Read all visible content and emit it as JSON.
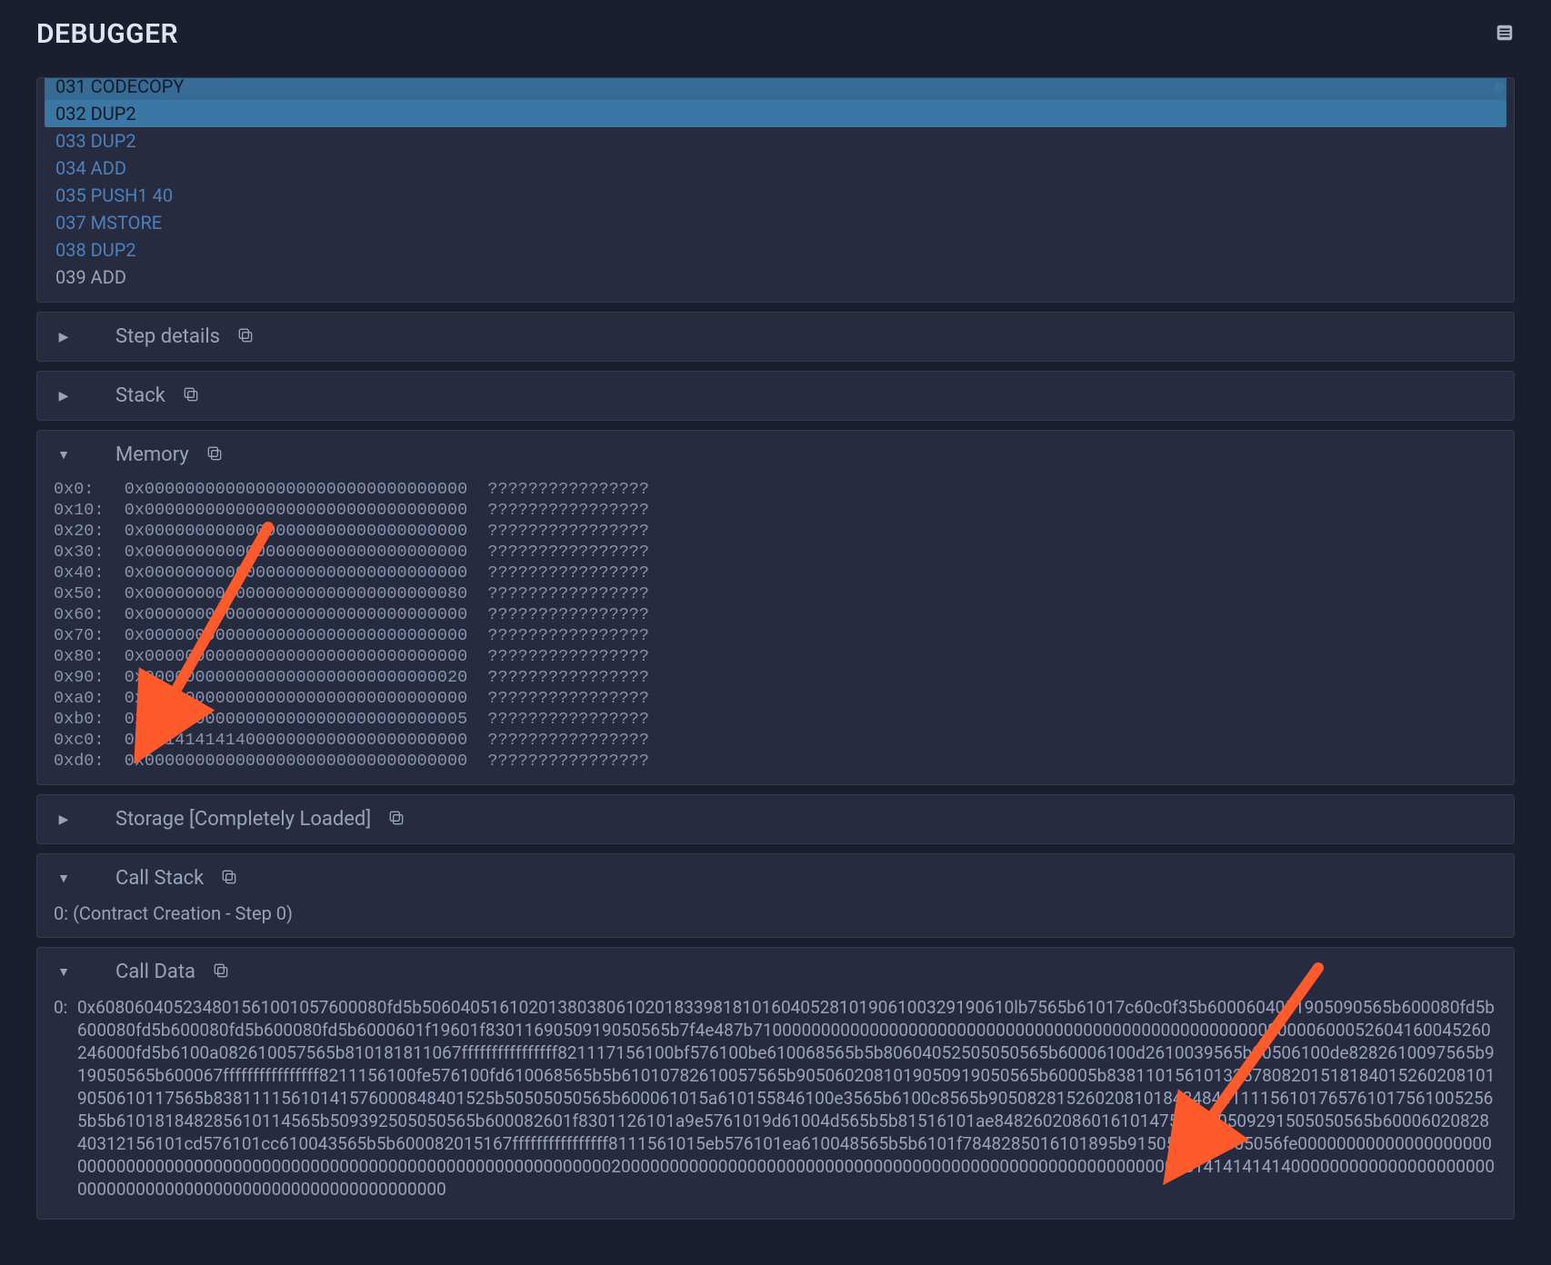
{
  "header": {
    "title": "DEBUGGER"
  },
  "opcodes": [
    {
      "text": "031 CODECOPY",
      "cls": "faded-top"
    },
    {
      "text": "032 DUP2",
      "cls": "current"
    },
    {
      "text": "033 DUP2",
      "cls": ""
    },
    {
      "text": "034 ADD",
      "cls": ""
    },
    {
      "text": "035 PUSH1 40",
      "cls": ""
    },
    {
      "text": "037 MSTORE",
      "cls": ""
    },
    {
      "text": "038 DUP2",
      "cls": ""
    },
    {
      "text": "039 ADD",
      "cls": "later"
    }
  ],
  "sections": {
    "step_details": "Step details",
    "stack": "Stack",
    "memory": "Memory",
    "storage": "Storage [Completely Loaded]",
    "call_stack": "Call Stack",
    "call_data": "Call Data"
  },
  "memory_rows": [
    {
      "addr": "0x0:",
      "hex": "0x00000000000000000000000000000000",
      "ascii": "????????????????"
    },
    {
      "addr": "0x10:",
      "hex": "0x00000000000000000000000000000000",
      "ascii": "????????????????"
    },
    {
      "addr": "0x20:",
      "hex": "0x00000000000000000000000000000000",
      "ascii": "????????????????"
    },
    {
      "addr": "0x30:",
      "hex": "0x00000000000000000000000000000000",
      "ascii": "????????????????"
    },
    {
      "addr": "0x40:",
      "hex": "0x00000000000000000000000000000000",
      "ascii": "????????????????"
    },
    {
      "addr": "0x50:",
      "hex": "0x00000000000000000000000000000080",
      "ascii": "????????????????"
    },
    {
      "addr": "0x60:",
      "hex": "0x00000000000000000000000000000000",
      "ascii": "????????????????"
    },
    {
      "addr": "0x70:",
      "hex": "0x00000000000000000000000000000000",
      "ascii": "????????????????"
    },
    {
      "addr": "0x80:",
      "hex": "0x00000000000000000000000000000000",
      "ascii": "????????????????"
    },
    {
      "addr": "0x90:",
      "hex": "0x00000000000000000000000000000020",
      "ascii": "????????????????"
    },
    {
      "addr": "0xa0:",
      "hex": "0x00000000000000000000000000000000",
      "ascii": "????????????????"
    },
    {
      "addr": "0xb0:",
      "hex": "0x00000000000000000000000000000005",
      "ascii": "????????????????"
    },
    {
      "addr": "0xc0:",
      "hex": "0x14141414140000000000000000000000",
      "ascii": "????????????????"
    },
    {
      "addr": "0xd0:",
      "hex": "0x00000000000000000000000000000000",
      "ascii": "????????????????"
    }
  ],
  "call_stack": {
    "idx": "0:",
    "text": "(Contract Creation - Step 0)"
  },
  "call_data": {
    "idx": "0:",
    "hex": "0x608060405234801561001057600080fd5b5060405161020138038061020183398181016040528101906100329190610lb7565b61017c60c0f35b6000604051905090565b600080fd5b600080fd5b600080fd5b600080fd5b6000601f19601f8301169050919050565b7f4e487b7100000000000000000000000000000000000000000000000000000000600052604160045260246000fd5b6100a082610057565b810181811067ffffffffffffffff821117156100bf576100be610068565b5b80604052505050565b60006100d2610039565b90506100de8282610097565b919050565b600067ffffffffffffffff8211156100fe576100fd610068565b5b61010782610057565b9050602081019050919050565b60005b83811015610132578082015181840152602081019050610117565b83811115610141576000848401525b50505050565b600061015a610155846100e3565b6100c8565b90508281526020810184848401111561017657610175610052565b5b610181848285610114565b509392505050565b600082601f8301126101a9e5761019d61004d565b5b81516101ae8482602086016101475b9150509291505050565b6000602082840312156101cd576101cc610043565b5b600082015167ffffffffffffffff8111561015eb576101ea610048565b5b6101f7848285016101895b9150509291505056fe000000000000000000000000000000000000000000000000000000000000000000000000000200000000000000000000000000000000000000000000000000000000005141414141400000000000000000000000000000000000000000000000000000000000"
  }
}
